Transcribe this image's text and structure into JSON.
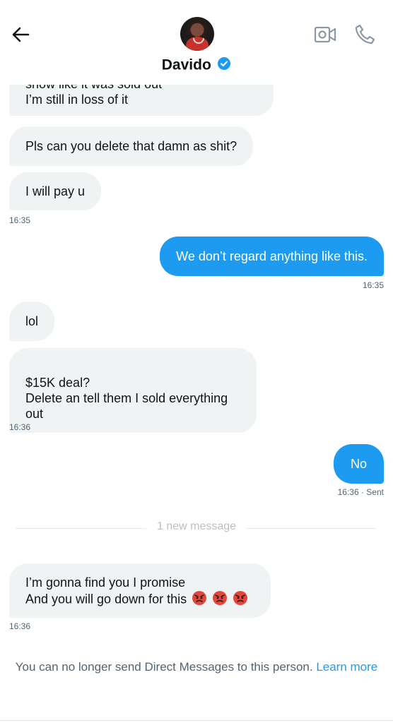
{
  "header": {
    "contact_name": "Davido"
  },
  "messages": {
    "m1_partial": "show like it was sold out",
    "m1_text": "I’m still in loss of it",
    "m2_text": "Pls can you delete that damn as shit?",
    "m3_text": "I will pay u",
    "t1": "16:35",
    "m4_text": "We don’t regard  anything like this.",
    "t2": "16:35",
    "m5_text": "lol",
    "m6_text": "$15K deal?\nDelete an tell them I sold everything\nout",
    "t3": "16:36",
    "m7_text": "No",
    "t4": "16:36 · Sent",
    "divider": "1 new message",
    "m8_line1": "I’m gonna find you I promise",
    "m8_line2": "And you will go down for this",
    "t5": "16:36"
  },
  "footer": {
    "notice": "You can no longer send Direct Messages to this person.",
    "link": "Learn more"
  },
  "colors": {
    "accent": "#1d9bf0",
    "incoming_bubble": "#eff3f4",
    "muted_text": "#536471"
  },
  "icons": [
    "back-arrow-icon",
    "verified-badge-icon",
    "video-call-icon",
    "phone-icon",
    "angry-face-icon"
  ]
}
